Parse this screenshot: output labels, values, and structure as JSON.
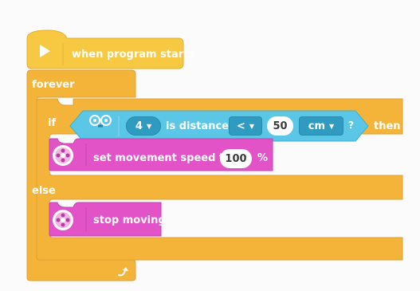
{
  "hat_block": {
    "label": "when program starts",
    "icon": "play-icon"
  },
  "forever_block": {
    "label": "forever",
    "icon_end": "loop-arrow-icon"
  },
  "if_block": {
    "if_label": "if",
    "else_label": "else",
    "then_label": "then"
  },
  "condition": {
    "sensor_icon": "distance-sensor-icon",
    "port": "4",
    "label": "is distance",
    "comparator": "<",
    "value": "50",
    "unit": "cm",
    "help": "?"
  },
  "set_speed_block": {
    "label": "set movement speed to",
    "value": "100",
    "unit": "%",
    "icon": "movement-motor-icon"
  },
  "stop_block": {
    "label": "stop moving",
    "icon": "movement-motor-icon"
  },
  "colors": {
    "control": "#f4b43a",
    "control_dark": "#d9982a",
    "hat": "#f7c842",
    "sensor": "#5cc6e6",
    "movement": "#e253c8",
    "movement_dark": "#b53ca0"
  }
}
